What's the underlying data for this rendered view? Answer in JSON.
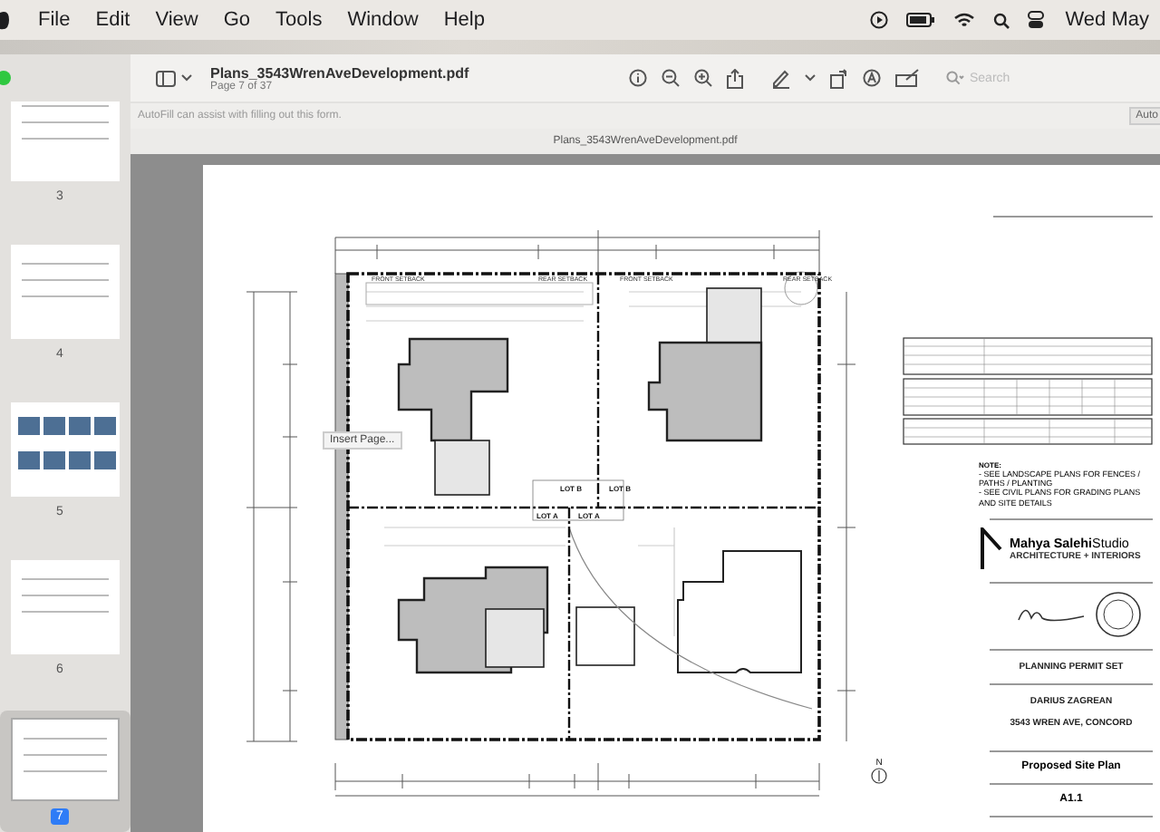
{
  "menu_bar": {
    "items": [
      "File",
      "Edit",
      "View",
      "Go",
      "Tools",
      "Window",
      "Help"
    ],
    "clock": "Wed May"
  },
  "toolbar": {
    "title": "Plans_3543WrenAveDevelopment.pdf",
    "subtitle": "Page 7 of 37",
    "search": {
      "placeholder": "Search"
    }
  },
  "autofill_bar": {
    "message": "AutoFill can assist with filling out this form.",
    "button": "Auto"
  },
  "document_title": "Plans_3543WrenAveDevelopment.pdf",
  "sidebar": {
    "pages": [
      {
        "label": "3",
        "kind": "plan",
        "selected": false
      },
      {
        "label": "4",
        "kind": "plan",
        "selected": false
      },
      {
        "label": "5",
        "kind": "photos",
        "selected": false
      },
      {
        "label": "6",
        "kind": "plan",
        "selected": false
      },
      {
        "label": "7",
        "kind": "plan",
        "selected": true
      }
    ]
  },
  "site_plan": {
    "setbacks": [
      "FRONT SETBACK",
      "REAR SETBACK",
      "FRONT SETBACK",
      "REAR SETBACK"
    ],
    "lot_tags": [
      "LOT B",
      "LOT B",
      "LOT A",
      "LOT A"
    ],
    "north_label": "N",
    "tooltip": "Insert Page..."
  },
  "title_block": {
    "note_heading": "NOTE:",
    "notes": [
      "- SEE LANDSCAPE PLANS FOR FENCES / PATHS / PLANTING",
      "- SEE CIVIL PLANS FOR GRADING PLANS AND SITE DETAILS"
    ],
    "studio_name": "**Mahya Salehi**Studio",
    "studio_tagline": "ARCHITECTURE + INTERIORS",
    "phase": "PLANNING PERMIT SET",
    "client": "DARIUS ZAGREAN",
    "project": "3543 WREN AVE, CONCORD",
    "sheet_title": "Proposed Site Plan",
    "sheet_number": "A1.1"
  }
}
